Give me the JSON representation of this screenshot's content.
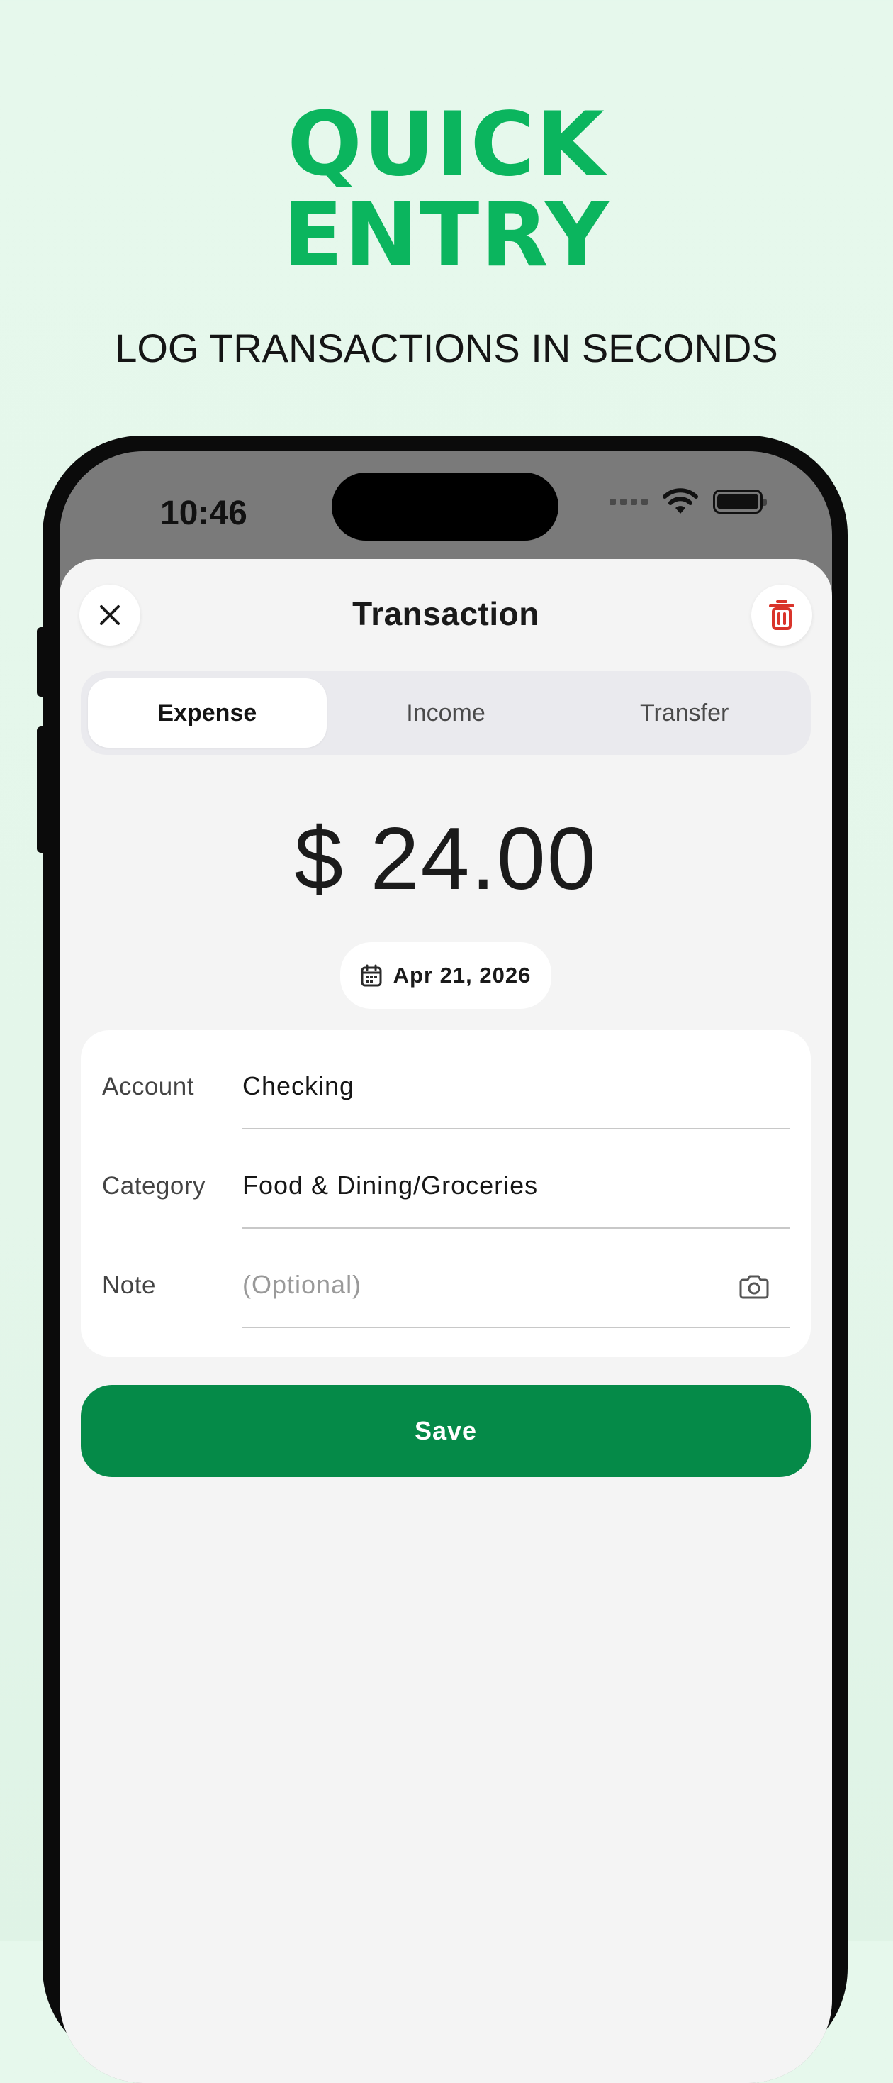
{
  "hero": {
    "title_line1": "QUICK",
    "title_line2": "ENTRY",
    "subtitle": "LOG TRANSACTIONS IN SECONDS"
  },
  "status_bar": {
    "time": "10:46"
  },
  "sheet": {
    "title": "Transaction",
    "close_icon": "close-icon",
    "delete_icon": "trash-icon"
  },
  "tabs": [
    {
      "label": "Expense",
      "active": true
    },
    {
      "label": "Income",
      "active": false
    },
    {
      "label": "Transfer",
      "active": false
    }
  ],
  "amount": "$ 24.00",
  "date": "Apr 21, 2026",
  "form": {
    "account": {
      "label": "Account",
      "value": "Checking"
    },
    "category": {
      "label": "Category",
      "value": "Food & Dining/Groceries"
    },
    "note": {
      "label": "Note",
      "placeholder": "(Optional)"
    }
  },
  "save_label": "Save",
  "colors": {
    "accent": "#0bb55e",
    "save": "#058a48",
    "delete": "#d9342b"
  }
}
